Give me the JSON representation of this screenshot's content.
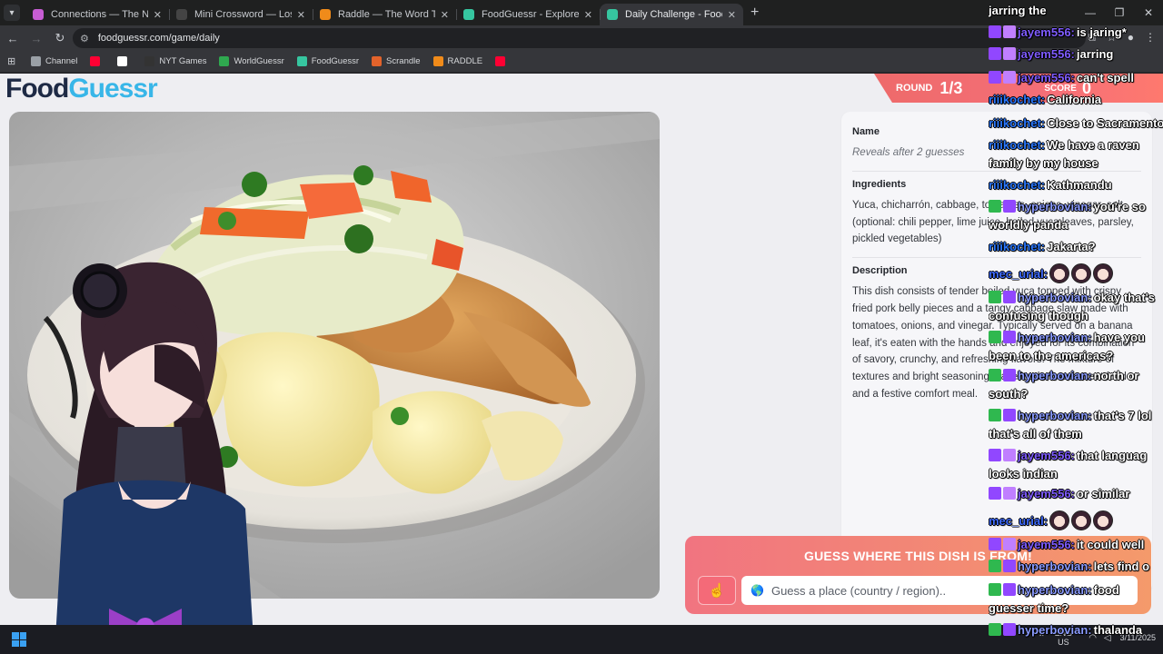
{
  "browser": {
    "tabs": [
      {
        "title": "Connections — The New York Ti",
        "color": "#c75dd3"
      },
      {
        "title": "Mini Crossword — Los Angeles T",
        "color": "#444444"
      },
      {
        "title": "Raddle — The Word Transformati",
        "color": "#f08b1a"
      },
      {
        "title": "FoodGuessr - Explore the world",
        "color": "#36c6a0"
      },
      {
        "title": "Daily Challenge - FoodGuessr |",
        "color": "#36c6a0",
        "active": true
      }
    ],
    "url": "foodguessr.com/game/daily",
    "bookmarks": [
      {
        "label": "Channel",
        "color": "#9aa0a6"
      },
      {
        "label": "",
        "color": "#ff0033"
      },
      {
        "label": "",
        "color": "#ffffff"
      },
      {
        "label": "NYT Games",
        "color": "#333333"
      },
      {
        "label": "WorldGuessr",
        "color": "#2fa84f"
      },
      {
        "label": "FoodGuessr",
        "color": "#36c6a0"
      },
      {
        "label": "Scrandle",
        "color": "#e3632b"
      },
      {
        "label": "RADDLE",
        "color": "#f08b1a"
      },
      {
        "label": "",
        "color": "#ff0033"
      }
    ]
  },
  "game": {
    "logo_part1": "Food",
    "logo_part2": "Guessr",
    "round_label": "ROUND",
    "round_value": "1/3",
    "score_label": "SCORE",
    "score_value": "0",
    "name_heading": "Name",
    "name_value": "Reveals after 2 guesses",
    "ingredients_heading": "Ingredients",
    "ingredients_value": "Yuca, chicharrón, cabbage, tomatoes, onions, vinegar, salt, (optional: chili pepper, lime juice, boiled yuca leaves, parsley, pickled vegetables)",
    "description_heading": "Description",
    "description_value": "This dish consists of tender boiled yuca topped with crispy fried pork belly pieces and a tangy cabbage slaw made with tomatoes, onions, and vinegar. Typically served on a banana leaf, it's eaten with the hands and enjoyed for its combination of savory, crunchy, and refreshing flavors. The mixture of textures and bright seasoning make it a beloved street food and a festive comfort meal.",
    "guess_title": "GUESS WHERE THIS DISH IS FROM!",
    "guess_placeholder": "Guess a place (country / region).."
  },
  "taskbar": {
    "lang_top": "ENG",
    "lang_bottom": "US",
    "date": "3/11/2025"
  },
  "chat": [
    {
      "user": "",
      "text": "jarring the",
      "cls": "j",
      "badges": []
    },
    {
      "user": "jayem556:",
      "text": "is jaring*",
      "cls": "j",
      "badges": [
        "b1",
        "b3"
      ]
    },
    {
      "user": "jayem556:",
      "text": "jarring",
      "cls": "j",
      "badges": [
        "b1",
        "b3"
      ]
    },
    {
      "user": "jayem556:",
      "text": "can't spell",
      "cls": "j",
      "badges": [
        "b1",
        "b3"
      ]
    },
    {
      "user": "riiikochet:",
      "text": "California",
      "cls": "r",
      "badges": []
    },
    {
      "user": "riiikochet:",
      "text": "Close to Sacramento",
      "cls": "r",
      "badges": []
    },
    {
      "user": "riiikochet:",
      "text": "We have a raven",
      "cont": "family by my house",
      "cls": "r",
      "badges": []
    },
    {
      "user": "riiikochet:",
      "text": "Kathmandu",
      "cls": "r",
      "badges": []
    },
    {
      "user": "hyperbovian:",
      "text": "you're so",
      "cont": "worldly panda",
      "cls": "h",
      "badges": [
        "b2",
        "b1"
      ]
    },
    {
      "user": "riiikochet:",
      "text": "Jakarta?",
      "cls": "r",
      "badges": []
    },
    {
      "user": "mec_urial:",
      "text": "",
      "emotes": 3,
      "cls": "m",
      "badges": []
    },
    {
      "user": "hyperbovian:",
      "text": "okay that's",
      "cont": "confusing though",
      "cls": "h",
      "badges": [
        "b2",
        "b1"
      ]
    },
    {
      "user": "hyperbovian:",
      "text": "have you",
      "cont": "been to the americas?",
      "cls": "h",
      "badges": [
        "b2",
        "b1"
      ]
    },
    {
      "user": "hyperbovian:",
      "text": "north or",
      "cont": "south?",
      "cls": "h",
      "badges": [
        "b2",
        "b1"
      ]
    },
    {
      "user": "hyperbovian:",
      "text": "that's 7 lol",
      "cont": "that's all of them",
      "cls": "h",
      "badges": [
        "b2",
        "b1"
      ]
    },
    {
      "user": "jayem556:",
      "text": "that languag",
      "cont": "looks indian",
      "cls": "j",
      "badges": [
        "b1",
        "b3"
      ]
    },
    {
      "user": "jayem556:",
      "text": "or similar",
      "cls": "j",
      "badges": [
        "b1",
        "b3"
      ]
    },
    {
      "user": "mec_urial:",
      "text": "",
      "emotes": 3,
      "cls": "m",
      "badges": []
    },
    {
      "user": "jayem556:",
      "text": "it could well",
      "cls": "j",
      "badges": [
        "b1",
        "b3"
      ]
    },
    {
      "user": "hyperbovian:",
      "text": "lets find o",
      "cls": "h",
      "badges": [
        "b2",
        "b1"
      ]
    },
    {
      "user": "hyperbovian:",
      "text": "food",
      "cont": "guesser time?",
      "cls": "h",
      "badges": [
        "b2",
        "b1"
      ]
    },
    {
      "user": "hyperbovian:",
      "text": "thalanda",
      "cls": "h",
      "badges": [
        "b2",
        "b1"
      ]
    }
  ]
}
